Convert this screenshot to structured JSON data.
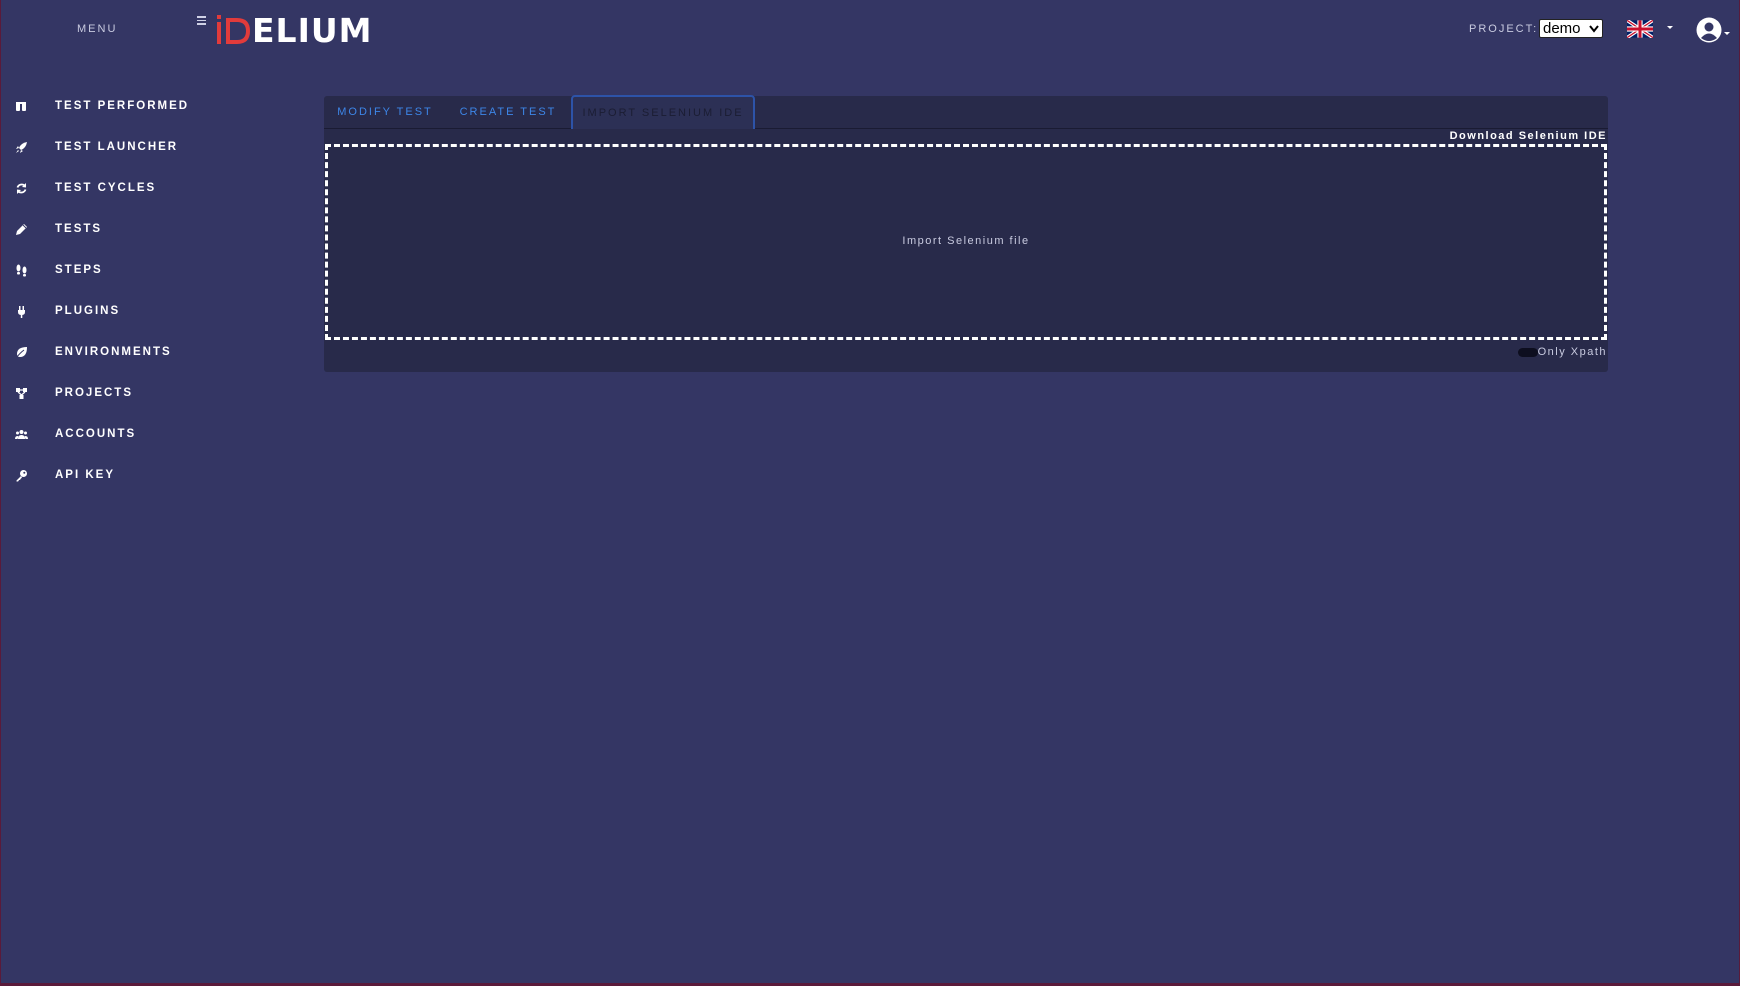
{
  "colors": {
    "background": "#343664",
    "panel": "#282a4a",
    "accent_tab": "#3d86e8",
    "logo_red": "#e23b3b"
  },
  "header": {
    "menu_label": "MENU",
    "logo_text": "ELIUM",
    "project_label": "PROJECT:",
    "project_value": "demo",
    "language_icon": "uk-flag-icon",
    "user_icon": "user-circle-icon"
  },
  "sidebar": {
    "items": [
      {
        "label": "TEST PERFORMED",
        "icon": "clipboard-icon"
      },
      {
        "label": "TEST LAUNCHER",
        "icon": "rocket-icon"
      },
      {
        "label": "TEST CYCLES",
        "icon": "refresh-icon"
      },
      {
        "label": "TESTS",
        "icon": "pencil-icon"
      },
      {
        "label": "STEPS",
        "icon": "footsteps-icon"
      },
      {
        "label": "PLUGINS",
        "icon": "plug-icon"
      },
      {
        "label": "ENVIRONMENTS",
        "icon": "leaf-icon"
      },
      {
        "label": "PROJECTS",
        "icon": "network-icon"
      },
      {
        "label": "ACCOUNTS",
        "icon": "users-icon"
      },
      {
        "label": "API KEY",
        "icon": "key-icon"
      }
    ]
  },
  "main": {
    "tabs": [
      {
        "label": "MODIFY TEST",
        "active": false
      },
      {
        "label": "CREATE TEST",
        "active": false
      },
      {
        "label": "IMPORT SELENIUM IDE",
        "active": true
      }
    ],
    "download_link": "Download Selenium IDE",
    "dropzone_label": "Import Selenium file",
    "xpath_toggle_label": "Only Xpath"
  }
}
